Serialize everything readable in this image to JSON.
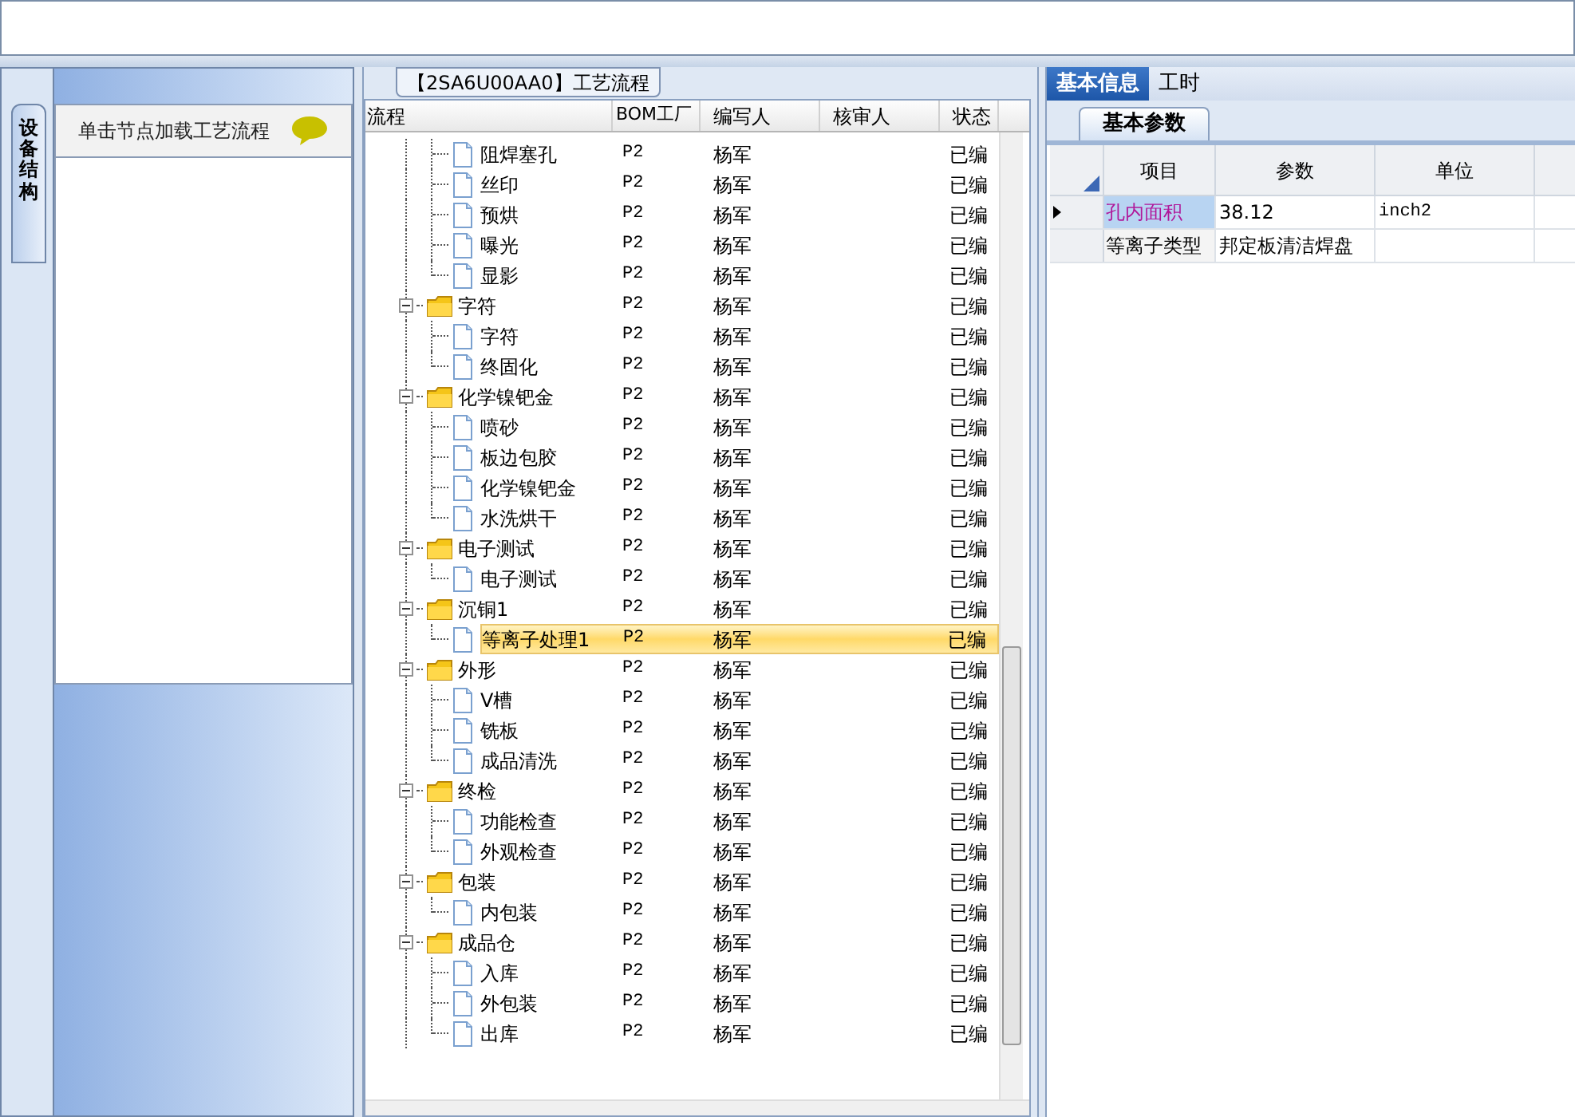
{
  "left_panel": {
    "side_tab": "设备结构",
    "hint": "单击节点加载工艺流程"
  },
  "process_panel": {
    "title": "【2SA6U00AA0】工艺流程",
    "columns": [
      "流程",
      "BOM工厂",
      "编写人",
      "核审人",
      "状态"
    ],
    "tree": [
      {
        "children": [
          {
            "label": "阻焊塞孔",
            "factory": "P2",
            "author": "杨军",
            "status": "已编",
            "selected": false
          },
          {
            "label": "丝印",
            "factory": "P2",
            "author": "杨军",
            "status": "已编",
            "selected": false
          },
          {
            "label": "预烘",
            "factory": "P2",
            "author": "杨军",
            "status": "已编",
            "selected": false
          },
          {
            "label": "曝光",
            "factory": "P2",
            "author": "杨军",
            "status": "已编",
            "selected": false
          },
          {
            "label": "显影",
            "factory": "P2",
            "author": "杨军",
            "status": "已编",
            "selected": false
          }
        ]
      },
      {
        "label": "字符",
        "factory": "P2",
        "author": "杨军",
        "status": "已编",
        "selected": false,
        "expanded": true,
        "children": [
          {
            "label": "字符",
            "factory": "P2",
            "author": "杨军",
            "status": "已编",
            "selected": false
          },
          {
            "label": "终固化",
            "factory": "P2",
            "author": "杨军",
            "status": "已编",
            "selected": false
          }
        ]
      },
      {
        "label": "化学镍钯金",
        "factory": "P2",
        "author": "杨军",
        "status": "已编",
        "selected": false,
        "expanded": true,
        "children": [
          {
            "label": "喷砂",
            "factory": "P2",
            "author": "杨军",
            "status": "已编",
            "selected": false
          },
          {
            "label": "板边包胶",
            "factory": "P2",
            "author": "杨军",
            "status": "已编",
            "selected": false
          },
          {
            "label": "化学镍钯金",
            "factory": "P2",
            "author": "杨军",
            "status": "已编",
            "selected": false
          },
          {
            "label": "水洗烘干",
            "factory": "P2",
            "author": "杨军",
            "status": "已编",
            "selected": false
          }
        ]
      },
      {
        "label": "电子测试",
        "factory": "P2",
        "author": "杨军",
        "status": "已编",
        "selected": false,
        "expanded": true,
        "children": [
          {
            "label": "电子测试",
            "factory": "P2",
            "author": "杨军",
            "status": "已编",
            "selected": false
          }
        ]
      },
      {
        "label": "沉铜1",
        "factory": "P2",
        "author": "杨军",
        "status": "已编",
        "selected": false,
        "expanded": true,
        "children": [
          {
            "label": "等离子处理1",
            "factory": "P2",
            "author": "杨军",
            "status": "已编",
            "selected": true
          }
        ]
      },
      {
        "label": "外形",
        "factory": "P2",
        "author": "杨军",
        "status": "已编",
        "selected": false,
        "expanded": true,
        "children": [
          {
            "label": "V槽",
            "factory": "P2",
            "author": "杨军",
            "status": "已编",
            "selected": false
          },
          {
            "label": "铣板",
            "factory": "P2",
            "author": "杨军",
            "status": "已编",
            "selected": false
          },
          {
            "label": "成品清洗",
            "factory": "P2",
            "author": "杨军",
            "status": "已编",
            "selected": false
          }
        ]
      },
      {
        "label": "终检",
        "factory": "P2",
        "author": "杨军",
        "status": "已编",
        "selected": false,
        "expanded": true,
        "children": [
          {
            "label": "功能检查",
            "factory": "P2",
            "author": "杨军",
            "status": "已编",
            "selected": false
          },
          {
            "label": "外观检查",
            "factory": "P2",
            "author": "杨军",
            "status": "已编",
            "selected": false
          }
        ]
      },
      {
        "label": "包装",
        "factory": "P2",
        "author": "杨军",
        "status": "已编",
        "selected": false,
        "expanded": true,
        "children": [
          {
            "label": "内包装",
            "factory": "P2",
            "author": "杨军",
            "status": "已编",
            "selected": false
          }
        ]
      },
      {
        "label": "成品仓",
        "factory": "P2",
        "author": "杨军",
        "status": "已编",
        "selected": false,
        "expanded": true,
        "children": [
          {
            "label": "入库",
            "factory": "P2",
            "author": "杨军",
            "status": "已编",
            "selected": false
          },
          {
            "label": "外包装",
            "factory": "P2",
            "author": "杨军",
            "status": "已编",
            "selected": false
          },
          {
            "label": "出库",
            "factory": "P2",
            "author": "杨军",
            "status": "已编",
            "selected": false
          }
        ]
      }
    ]
  },
  "info_panel": {
    "tabs": [
      {
        "label": "基本信息",
        "selected": true
      },
      {
        "label": "工时",
        "selected": false
      }
    ],
    "sub_tabs": [
      {
        "label": "基本参数",
        "selected": true
      }
    ],
    "columns": [
      "项目",
      "参数",
      "单位"
    ],
    "rows": [
      {
        "item": "孔内面积",
        "value": "38.12",
        "unit": "inch2",
        "selected": true
      },
      {
        "item": "等离子类型",
        "value": "邦定板清洁焊盘",
        "unit": "",
        "selected": false
      }
    ]
  }
}
